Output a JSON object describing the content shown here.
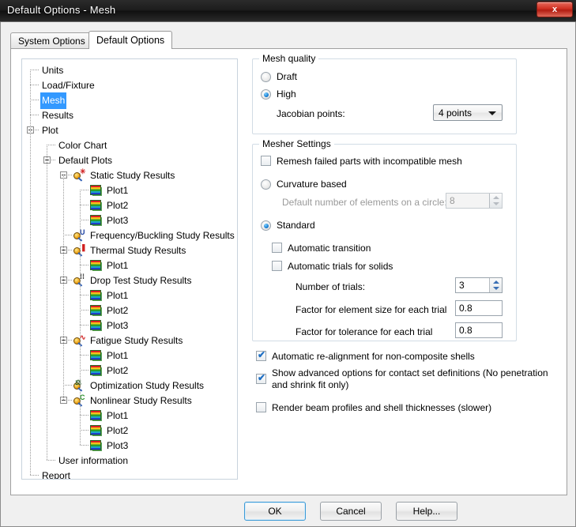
{
  "window": {
    "title": "Default Options - Mesh",
    "close_label": "x"
  },
  "tabs": [
    {
      "label": "System Options",
      "active": false
    },
    {
      "label": "Default Options",
      "active": true
    }
  ],
  "tree": {
    "items": [
      {
        "label": "Units",
        "indent": 0,
        "icon": "none",
        "twisty": "none",
        "selected": false
      },
      {
        "label": "Load/Fixture",
        "indent": 0,
        "icon": "none",
        "twisty": "none",
        "selected": false
      },
      {
        "label": "Mesh",
        "indent": 0,
        "icon": "none",
        "twisty": "none",
        "selected": true
      },
      {
        "label": "Results",
        "indent": 0,
        "icon": "none",
        "twisty": "none",
        "selected": false
      },
      {
        "label": "Plot",
        "indent": 0,
        "icon": "none",
        "twisty": "expanded",
        "selected": false
      },
      {
        "label": "Color Chart",
        "indent": 1,
        "icon": "none",
        "twisty": "none",
        "selected": false
      },
      {
        "label": "Default Plots",
        "indent": 1,
        "icon": "none",
        "twisty": "expanded",
        "selected": false
      },
      {
        "label": "Static Study Results",
        "indent": 2,
        "icon": "study-static",
        "twisty": "expanded",
        "selected": false
      },
      {
        "label": "Plot1",
        "indent": 3,
        "icon": "plot",
        "twisty": "none",
        "selected": false
      },
      {
        "label": "Plot2",
        "indent": 3,
        "icon": "plot",
        "twisty": "none",
        "selected": false
      },
      {
        "label": "Plot3",
        "indent": 3,
        "icon": "plot",
        "twisty": "none",
        "selected": false
      },
      {
        "label": "Frequency/Buckling Study Results",
        "indent": 2,
        "icon": "study-freq",
        "twisty": "none",
        "selected": false
      },
      {
        "label": "Thermal Study Results",
        "indent": 2,
        "icon": "study-thermal",
        "twisty": "expanded",
        "selected": false
      },
      {
        "label": "Plot1",
        "indent": 3,
        "icon": "plot",
        "twisty": "none",
        "selected": false
      },
      {
        "label": "Drop Test Study Results",
        "indent": 2,
        "icon": "study-drop",
        "twisty": "expanded",
        "selected": false
      },
      {
        "label": "Plot1",
        "indent": 3,
        "icon": "plot",
        "twisty": "none",
        "selected": false
      },
      {
        "label": "Plot2",
        "indent": 3,
        "icon": "plot",
        "twisty": "none",
        "selected": false
      },
      {
        "label": "Plot3",
        "indent": 3,
        "icon": "plot",
        "twisty": "none",
        "selected": false
      },
      {
        "label": "Fatigue Study Results",
        "indent": 2,
        "icon": "study-fatigue",
        "twisty": "expanded",
        "selected": false
      },
      {
        "label": "Plot1",
        "indent": 3,
        "icon": "plot",
        "twisty": "none",
        "selected": false
      },
      {
        "label": "Plot2",
        "indent": 3,
        "icon": "plot",
        "twisty": "none",
        "selected": false
      },
      {
        "label": "Optimization Study Results",
        "indent": 2,
        "icon": "study-optim",
        "twisty": "none",
        "selected": false
      },
      {
        "label": "Nonlinear Study Results",
        "indent": 2,
        "icon": "study-nonlin",
        "twisty": "expanded",
        "selected": false
      },
      {
        "label": "Plot1",
        "indent": 3,
        "icon": "plot",
        "twisty": "none",
        "selected": false
      },
      {
        "label": "Plot2",
        "indent": 3,
        "icon": "plot",
        "twisty": "none",
        "selected": false
      },
      {
        "label": "Plot3",
        "indent": 3,
        "icon": "plot",
        "twisty": "none",
        "selected": false
      },
      {
        "label": "User information",
        "indent": 1,
        "icon": "none",
        "twisty": "none",
        "selected": false
      },
      {
        "label": "Report",
        "indent": 0,
        "icon": "none",
        "twisty": "none",
        "selected": false
      }
    ]
  },
  "mesh_quality": {
    "title": "Mesh quality",
    "draft_label": "Draft",
    "high_label": "High",
    "selected": "High",
    "jacobian_label": "Jacobian points:",
    "jacobian_value": "4 points"
  },
  "mesher_settings": {
    "title": "Mesher Settings",
    "remesh_label": "Remesh failed parts with incompatible mesh",
    "remesh_checked": false,
    "curvature_label": "Curvature based",
    "standard_label": "Standard",
    "selected_mesher": "Standard",
    "circle_elements_label": "Default number of elements on a circle:",
    "circle_elements_value": "8",
    "auto_transition_label": "Automatic transition",
    "auto_transition_checked": false,
    "auto_trials_label": "Automatic trials for solids",
    "auto_trials_checked": false,
    "num_trials_label": "Number of trials:",
    "num_trials_value": "3",
    "factor_element_label": "Factor for element size for each trial",
    "factor_element_value": "0.8",
    "factor_tolerance_label": "Factor for tolerance for each trial",
    "factor_tolerance_value": "0.8"
  },
  "options": {
    "realign_label": "Automatic re-alignment for non-composite shells",
    "realign_checked": true,
    "advanced_label": "Show advanced options for contact set definitions (No penetration and shrink fit only)",
    "advanced_checked": true,
    "render_beam_label": "Render beam profiles and shell thicknesses (slower)",
    "render_beam_checked": false
  },
  "buttons": {
    "ok": "OK",
    "cancel": "Cancel",
    "help": "Help..."
  },
  "colors": {
    "accent": "#3399ff",
    "title_bar": "#1c1c1c",
    "close": "#cf2f21",
    "check": "#1f6fc4"
  }
}
